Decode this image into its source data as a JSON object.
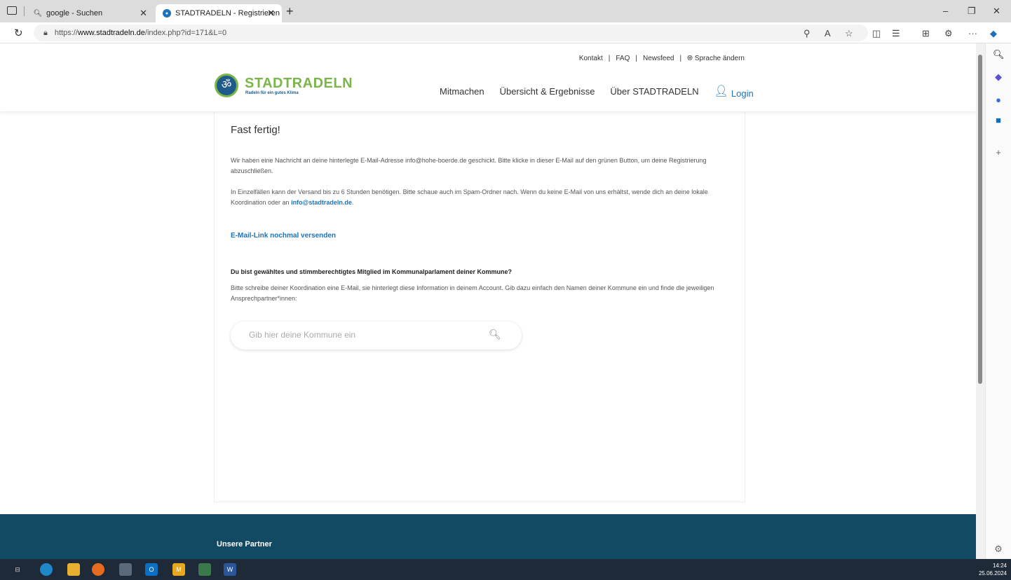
{
  "browser": {
    "tabs": [
      {
        "title": "google - Suchen",
        "icon": "search-icon"
      },
      {
        "title": "STADTRADELN - Registrieren",
        "icon": "site-icon"
      }
    ],
    "new_tab": "+",
    "window_controls": {
      "minimize": "–",
      "restore": "❐",
      "close": "✕"
    },
    "url_prefix": "https://",
    "url_host": "www.stadtradeln.de",
    "url_path": "/index.php?id=171&L=0",
    "toolbar_more": "···"
  },
  "page": {
    "topnav": {
      "kontakt": "Kontakt",
      "faq": "FAQ",
      "newsfeed": "Newsfeed",
      "language": "Sprache ändern",
      "sep": "|"
    },
    "logo": {
      "name": "STADTRADELN",
      "tagline": "Radeln für ein gutes Klima"
    },
    "mainnav": {
      "mitmachen": "Mitmachen",
      "uebersicht": "Übersicht & Ergebnisse",
      "ueber": "Über STADTRADELN",
      "login": "Login"
    },
    "content": {
      "title": "Fast fertig!",
      "para1": "Wir haben eine Nachricht an deine hinterlegte E-Mail-Adresse info@hohe-boerde.de geschickt. Bitte klicke in dieser E-Mail auf den grünen Button, um deine Registrierung abzuschließen.",
      "para2_text": "In Einzelfällen kann der Versand bis zu 6 Stunden benötigen. Bitte schaue auch im Spam-Ordner nach. Wenn du keine E-Mail von uns erhältst, wende dich an deine lokale Koordination oder an ",
      "para2_link": "info@stadtradeln.de",
      "para2_end": ".",
      "resend_link": "E-Mail-Link nochmal versenden",
      "question": "Du bist gewähltes und stimmberechtigtes Mitglied im Kommunalparlament deiner Kommune?",
      "para3": "Bitte schreibe deiner Koordination eine E-Mail, sie hinterlegt diese Information in deinem Account. Gib dazu einfach den Namen deiner Kommune ein und finde die jeweiligen Ansprechpartner*innen:",
      "search_placeholder": "Gib hier deine Kommune ein"
    },
    "footer": {
      "partners": "Unsere Partner"
    }
  },
  "taskbar": {
    "time": "14:24",
    "date": "25.06.2024"
  },
  "colors": {
    "brand_green": "#7ab648",
    "brand_blue": "#1e5b8c",
    "link_blue": "#1e72b8",
    "footer": "#134a63"
  }
}
